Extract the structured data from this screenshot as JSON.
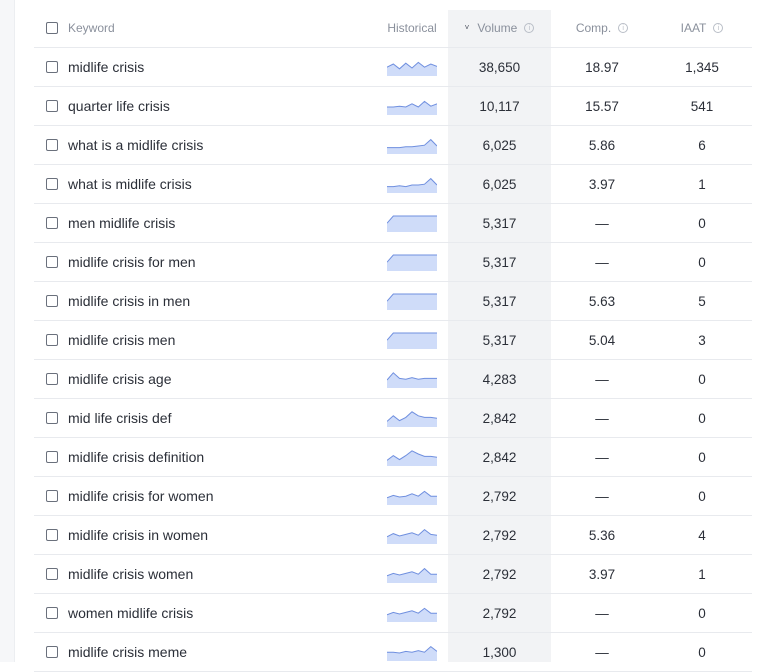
{
  "header": {
    "keyword": "Keyword",
    "historical": "Historical",
    "volume": "Volume",
    "comp": "Comp.",
    "iaat": "IAAT",
    "info_glyph": "i",
    "sort_glyph": "˅"
  },
  "colors": {
    "spark_fill": "#cfdcf9",
    "spark_line": "#6f8fdf"
  },
  "rows": [
    {
      "keyword": "midlife crisis",
      "volume": "38,650",
      "comp": "18.97",
      "iaat": "1,345",
      "trend": [
        0.55,
        0.75,
        0.45,
        0.8,
        0.5,
        0.85,
        0.55,
        0.75,
        0.6
      ]
    },
    {
      "keyword": "quarter life crisis",
      "volume": "10,117",
      "comp": "15.57",
      "iaat": "541",
      "trend": [
        0.5,
        0.5,
        0.55,
        0.5,
        0.7,
        0.5,
        0.85,
        0.55,
        0.7
      ]
    },
    {
      "keyword": "what is a midlife crisis",
      "volume": "6,025",
      "comp": "5.86",
      "iaat": "6",
      "trend": [
        0.4,
        0.4,
        0.4,
        0.45,
        0.45,
        0.5,
        0.55,
        0.9,
        0.5
      ]
    },
    {
      "keyword": "what is midlife crisis",
      "volume": "6,025",
      "comp": "3.97",
      "iaat": "1",
      "trend": [
        0.4,
        0.4,
        0.45,
        0.4,
        0.5,
        0.5,
        0.55,
        0.9,
        0.5
      ]
    },
    {
      "keyword": "men midlife crisis",
      "volume": "5,317",
      "comp": "—",
      "iaat": "0",
      "trend": [
        0.55,
        1,
        1,
        1,
        1,
        1,
        1,
        1,
        1
      ]
    },
    {
      "keyword": "midlife crisis for men",
      "volume": "5,317",
      "comp": "—",
      "iaat": "0",
      "trend": [
        0.55,
        1,
        1,
        1,
        1,
        1,
        1,
        1,
        1
      ]
    },
    {
      "keyword": "midlife crisis in men",
      "volume": "5,317",
      "comp": "5.63",
      "iaat": "5",
      "trend": [
        0.55,
        1,
        1,
        1,
        1,
        1,
        1,
        1,
        1
      ]
    },
    {
      "keyword": "midlife crisis men",
      "volume": "5,317",
      "comp": "5.04",
      "iaat": "3",
      "trend": [
        0.55,
        1,
        1,
        1,
        1,
        1,
        1,
        1,
        1
      ]
    },
    {
      "keyword": "midlife crisis age",
      "volume": "4,283",
      "comp": "—",
      "iaat": "0",
      "trend": [
        0.5,
        0.95,
        0.6,
        0.55,
        0.65,
        0.55,
        0.6,
        0.6,
        0.6
      ]
    },
    {
      "keyword": "mid life crisis def",
      "volume": "2,842",
      "comp": "—",
      "iaat": "0",
      "trend": [
        0.35,
        0.7,
        0.4,
        0.6,
        0.95,
        0.7,
        0.6,
        0.6,
        0.55
      ]
    },
    {
      "keyword": "midlife crisis definition",
      "volume": "2,842",
      "comp": "—",
      "iaat": "0",
      "trend": [
        0.35,
        0.65,
        0.4,
        0.65,
        0.95,
        0.75,
        0.6,
        0.6,
        0.55
      ]
    },
    {
      "keyword": "midlife crisis for women",
      "volume": "2,792",
      "comp": "—",
      "iaat": "0",
      "trend": [
        0.45,
        0.6,
        0.5,
        0.55,
        0.7,
        0.55,
        0.85,
        0.55,
        0.55
      ]
    },
    {
      "keyword": "midlife crisis in women",
      "volume": "2,792",
      "comp": "5.36",
      "iaat": "4",
      "trend": [
        0.45,
        0.65,
        0.5,
        0.6,
        0.7,
        0.55,
        0.9,
        0.6,
        0.55
      ]
    },
    {
      "keyword": "midlife crisis women",
      "volume": "2,792",
      "comp": "3.97",
      "iaat": "1",
      "trend": [
        0.45,
        0.6,
        0.5,
        0.6,
        0.7,
        0.55,
        0.9,
        0.55,
        0.55
      ]
    },
    {
      "keyword": "women midlife crisis",
      "volume": "2,792",
      "comp": "—",
      "iaat": "0",
      "trend": [
        0.45,
        0.6,
        0.5,
        0.6,
        0.7,
        0.55,
        0.85,
        0.55,
        0.55
      ]
    },
    {
      "keyword": "midlife crisis meme",
      "volume": "1,300",
      "comp": "—",
      "iaat": "0",
      "trend": [
        0.55,
        0.55,
        0.5,
        0.6,
        0.55,
        0.65,
        0.55,
        0.9,
        0.6
      ]
    }
  ]
}
